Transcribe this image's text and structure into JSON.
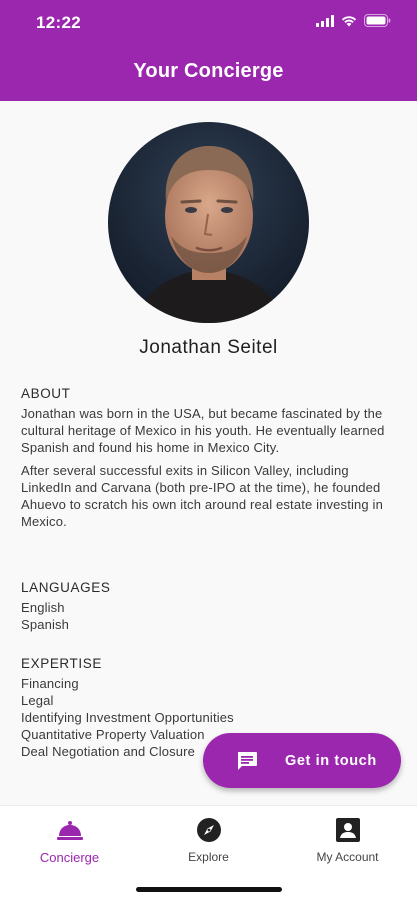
{
  "status_bar": {
    "time": "12:22"
  },
  "app_bar": {
    "title": "Your Concierge"
  },
  "profile": {
    "name": "Jonathan Seitel",
    "about": {
      "heading": "ABOUT",
      "paragraphs": [
        "Jonathan was born in the USA, but became fascinated by the cultural heritage of Mexico in his youth. He eventually learned Spanish and found his home in Mexico City.",
        "After several successful exits in Silicon Valley, including LinkedIn and Carvana (both pre-IPO at the time), he founded Ahuevo to scratch his own itch around real estate investing in Mexico."
      ]
    },
    "languages": {
      "heading": "LANGUAGES",
      "items": [
        "English",
        "Spanish"
      ]
    },
    "expertise": {
      "heading": "EXPERTISE",
      "items": [
        "Financing",
        "Legal",
        "Identifying Investment Opportunities",
        "Quantitative Property Valuation",
        "Deal Negotiation and Closure"
      ]
    }
  },
  "fab": {
    "label": "Get in touch",
    "icon": "chat-icon"
  },
  "bottom_nav": {
    "items": [
      {
        "label": "Concierge",
        "icon": "bell-icon",
        "active": true
      },
      {
        "label": "Explore",
        "icon": "compass-icon",
        "active": false
      },
      {
        "label": "My Account",
        "icon": "account-icon",
        "active": false
      }
    ]
  },
  "colors": {
    "primary": "#9b27af",
    "background": "#f9f9f9"
  }
}
